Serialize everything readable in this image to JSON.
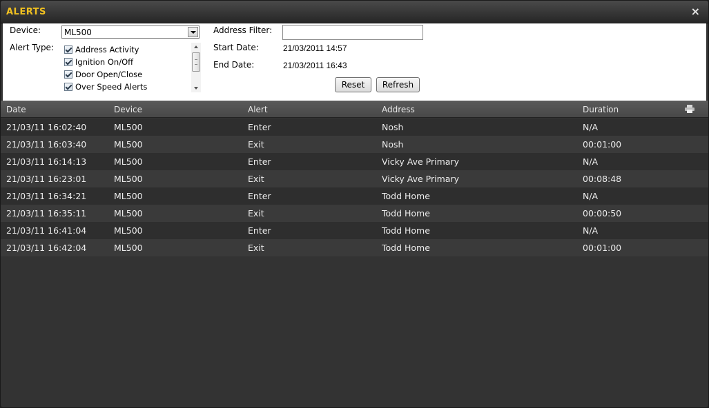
{
  "window": {
    "title": "ALERTS",
    "close_symbol": "×"
  },
  "filters": {
    "device_label": "Device:",
    "device_value": "ML500",
    "alert_type_label": "Alert Type:",
    "alert_types": [
      {
        "label": "Address Activity",
        "checked": true
      },
      {
        "label": "Ignition On/Off",
        "checked": true
      },
      {
        "label": "Door Open/Close",
        "checked": true
      },
      {
        "label": "Over Speed Alerts",
        "checked": true
      }
    ],
    "address_filter_label": "Address Filter:",
    "address_filter_value": "",
    "start_date_label": "Start Date:",
    "start_date_value": "21/03/2011 14:57",
    "end_date_label": "End Date:",
    "end_date_value": "21/03/2011 16:43",
    "reset_label": "Reset",
    "refresh_label": "Refresh"
  },
  "table": {
    "columns": [
      "Date",
      "Device",
      "Alert",
      "Address",
      "Duration"
    ],
    "rows": [
      [
        "21/03/11 16:02:40",
        "ML500",
        "Enter",
        "Nosh",
        "N/A"
      ],
      [
        "21/03/11 16:03:40",
        "ML500",
        "Exit",
        "Nosh",
        "00:01:00"
      ],
      [
        "21/03/11 16:14:13",
        "ML500",
        "Enter",
        "Vicky Ave Primary",
        "N/A"
      ],
      [
        "21/03/11 16:23:01",
        "ML500",
        "Exit",
        "Vicky Ave Primary",
        "00:08:48"
      ],
      [
        "21/03/11 16:34:21",
        "ML500",
        "Enter",
        "Todd Home",
        "N/A"
      ],
      [
        "21/03/11 16:35:11",
        "ML500",
        "Exit",
        "Todd Home",
        "00:00:50"
      ],
      [
        "21/03/11 16:41:04",
        "ML500",
        "Enter",
        "Todd Home",
        "N/A"
      ],
      [
        "21/03/11 16:42:04",
        "ML500",
        "Exit",
        "Todd Home",
        "00:01:00"
      ]
    ]
  },
  "colors": {
    "title_accent": "#f0c020",
    "row_odd": "#2e2e2e",
    "row_even": "#3a3a3a",
    "panel_bg": "#333333"
  },
  "icons": {
    "close": "close-icon",
    "print": "print-icon",
    "dropdown": "chevron-down-icon"
  }
}
